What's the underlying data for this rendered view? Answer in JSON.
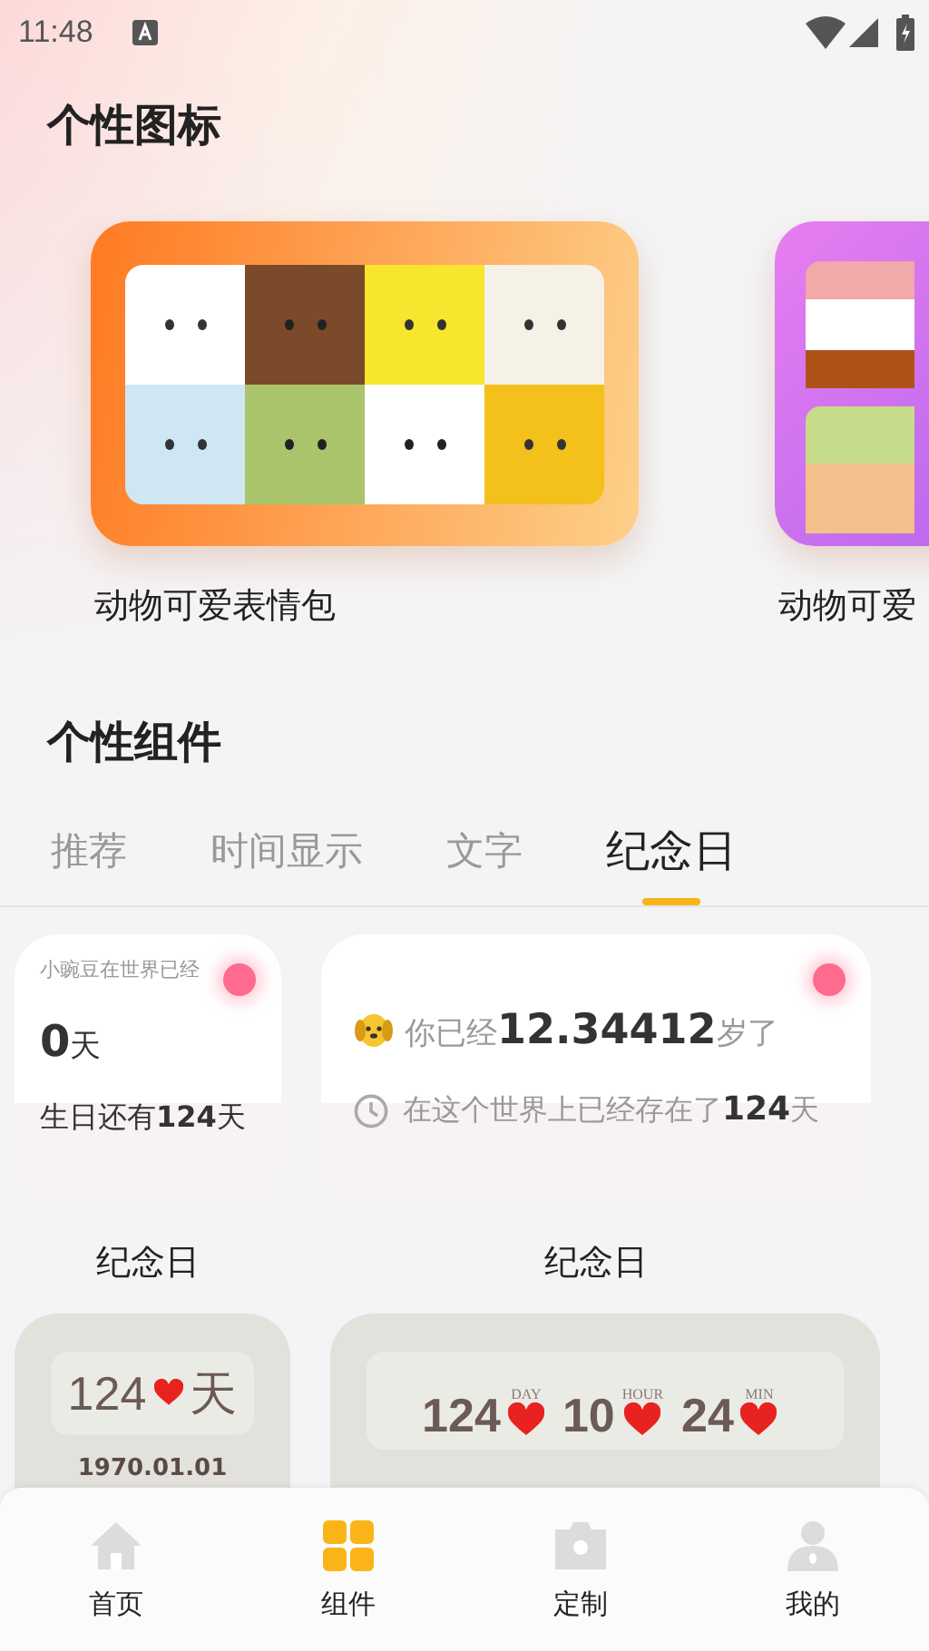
{
  "status_bar": {
    "time": "11:48"
  },
  "icon_section": {
    "title": "个性图标",
    "packs": [
      {
        "kind": "grid",
        "name": "动物可爱表情包"
      },
      {
        "kind": "column",
        "name": "动物可爱"
      }
    ]
  },
  "widget_section": {
    "title": "个性组件",
    "tabs": [
      {
        "label": "推荐",
        "selected": false
      },
      {
        "label": "时间显示",
        "selected": false
      },
      {
        "label": "文字",
        "selected": false
      },
      {
        "label": "纪念日",
        "selected": true
      }
    ]
  },
  "widgets": [
    {
      "kind": "birthday",
      "header": "小豌豆在世界已经",
      "days": "0",
      "unit": "天",
      "countdown": "生日还有**124**天",
      "caption": "纪念日"
    },
    {
      "kind": "age",
      "age_line": "你已经**12.34412**岁了",
      "existence": "在这个世界上已经存在了**124**天",
      "caption": "纪念日"
    },
    {
      "kind": "days_counter",
      "days": "124",
      "unit": "天",
      "date": "1970.01.01"
    },
    {
      "kind": "timer",
      "units": [
        {
          "value": "124",
          "label": "DAY"
        },
        {
          "value": "10",
          "label": "HOUR"
        },
        {
          "value": "24",
          "label": "MIN"
        }
      ]
    }
  ],
  "bottom_nav": [
    {
      "kind": "home",
      "label": "首页",
      "selected": false
    },
    {
      "kind": "widgets",
      "label": "组件",
      "selected": true
    },
    {
      "kind": "camera",
      "label": "定制",
      "selected": false
    },
    {
      "kind": "profile",
      "label": "我的",
      "selected": false
    }
  ]
}
